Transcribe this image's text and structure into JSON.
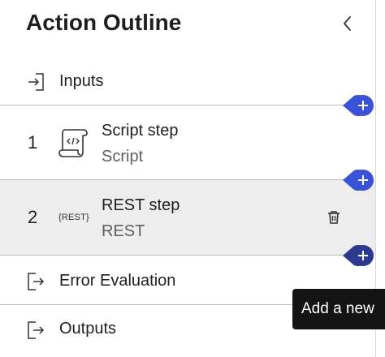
{
  "header": {
    "title": "Action Outline"
  },
  "inputs": {
    "label": "Inputs"
  },
  "steps": [
    {
      "number": "1",
      "name": "Script step",
      "type": "Script",
      "icon": "script-scroll-icon"
    },
    {
      "number": "2",
      "name": "REST step",
      "type": "REST",
      "icon": "rest-icon",
      "icon_text": "{REST}"
    }
  ],
  "error_evaluation": {
    "label": "Error Evaluation"
  },
  "outputs": {
    "label": "Outputs"
  },
  "tooltip": {
    "text": "Add a new"
  },
  "colors": {
    "accent": "#3a53d6",
    "selected_row": "#ededed",
    "tooltip_bg": "#141414",
    "divider": "#b8b8b8"
  }
}
